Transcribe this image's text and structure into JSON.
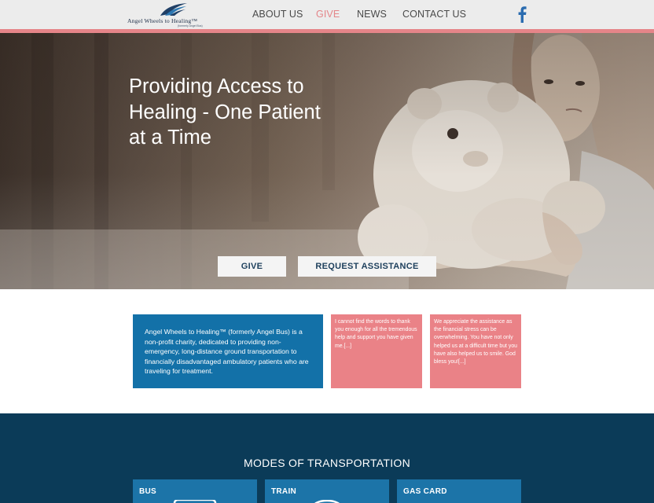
{
  "header": {
    "logo": {
      "name": "Angel Wheels to Healing™",
      "sub": "(formerly Angel Bus)"
    },
    "nav": [
      {
        "label": "ABOUT US"
      },
      {
        "label": "GIVE",
        "active": true
      },
      {
        "label": "NEWS"
      },
      {
        "label": "CONTACT US"
      }
    ],
    "social_icon": "facebook-icon"
  },
  "hero": {
    "title": "Providing Access to Healing - One Patient at a Time",
    "buttons": {
      "give": "GIVE",
      "request": "REQUEST ASSISTANCE"
    }
  },
  "intro": {
    "text": "Angel Wheels to Healing™ (formerly Angel Bus) is a non-profit charity, dedicated to providing non-emergency, long-distance ground transportation to financially disadvantaged ambulatory patients who are traveling for treatment."
  },
  "testimonials": [
    {
      "text": "I cannot find the words to thank you enough for all the tremendous help and support you have given me.[...]"
    },
    {
      "text": "We appreciate the assistance as the financial stress can be overwhelming. You have not only helped us at a difficult time but you have also helped us to smile. God bless you![...]"
    }
  ],
  "modes": {
    "title": "MODES OF TRANSPORTATION",
    "cards": [
      {
        "label": "BUS"
      },
      {
        "label": "TRAIN"
      },
      {
        "label": "GAS CARD"
      }
    ]
  },
  "colors": {
    "header_bg": "#ececec",
    "accent_pink": "#e58589",
    "intro_blue": "#1371a8",
    "testimonial_pink": "#ea8287",
    "modes_bg": "#0b3b58",
    "card_blue": "#1c74a8"
  }
}
